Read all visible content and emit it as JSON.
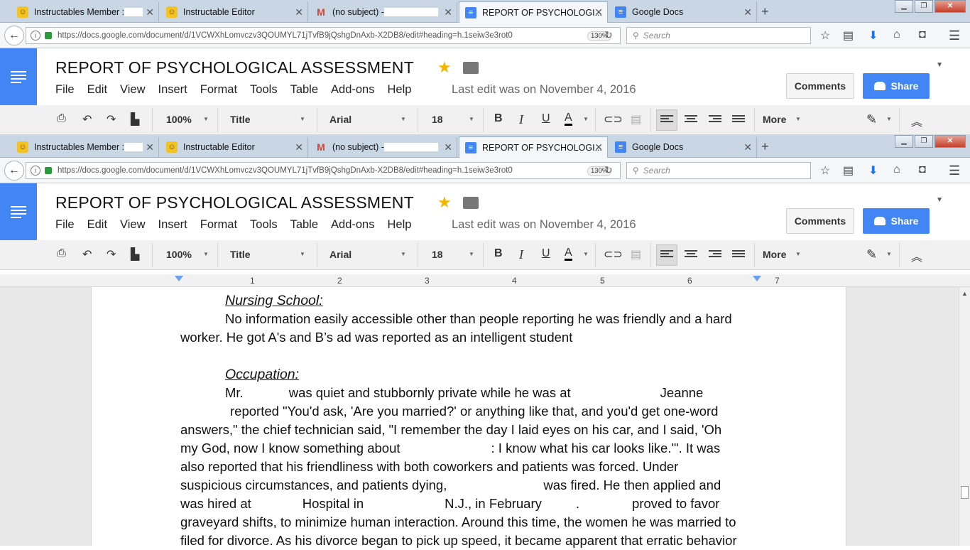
{
  "tabs": [
    {
      "title": "Instructables Member : ",
      "icon": "instructables-icon"
    },
    {
      "title": "Instructable Editor",
      "icon": "instructables-icon"
    },
    {
      "title": "(no subject) - ",
      "icon": "gmail-icon"
    },
    {
      "title": "REPORT OF PSYCHOLOGI...",
      "icon": "docs-icon"
    },
    {
      "title": "Google Docs",
      "icon": "docs-icon"
    }
  ],
  "browser": {
    "url": "https://docs.google.com/document/d/1VCWXhLomvczv3QOUMYL71jTvfB9jQshgDnAxb-X2DB8/edit#heading=h.1seiw3e3rot0",
    "zoom": "130%",
    "search_placeholder": "Search"
  },
  "doc": {
    "title": "REPORT OF PSYCHOLOGICAL ASSESSMENT",
    "last_edit": "Last edit was on November 4, 2016",
    "comments_label": "Comments",
    "share_label": "Share"
  },
  "menus": [
    "File",
    "Edit",
    "View",
    "Insert",
    "Format",
    "Tools",
    "Table",
    "Add-ons",
    "Help"
  ],
  "toolbar": {
    "zoom": "100%",
    "style": "Title",
    "font": "Arial",
    "size": "18",
    "bold": "B",
    "italic": "I",
    "underline": "U",
    "text_color": "A",
    "more": "More"
  },
  "ruler": [
    "1",
    "2",
    "3",
    "4",
    "5",
    "6",
    "7"
  ],
  "content": {
    "heading1": "Nursing School:",
    "para1_line1": "No information easily accessible other than people reporting he was friendly and a hard",
    "para1_line2": "worker. He got A's and B’s ad was reported as an intelligent student",
    "heading2": "Occupation:",
    "p2_l1a": "Mr.",
    "p2_l1b": "was quiet and stubbornly private while he was at",
    "p2_l1c": "Jeanne",
    "p2_l2": "reported \"You'd ask, 'Are you married?' or anything like that, and you'd get one-word",
    "p2_l3": "answers,\" the chief technician said, \"I remember the day I laid eyes on his car, and I said, 'Oh",
    "p2_l4a": "my God, now I know something about",
    "p2_l4b": ": I know what his car looks like.'\". It was",
    "p2_l5": "also reported that his friendliness with both coworkers and patients was forced. Under",
    "p2_l6a": "suspicious circumstances, and patients dying,",
    "p2_l6b": "was fired. He then applied and",
    "p2_l7a": "was hired at",
    "p2_l7b": "Hospital in",
    "p2_l7c": "N.J., in February",
    "p2_l7d": ".",
    "p2_l7e": "proved to favor",
    "p2_l8": "graveyard shifts, to minimize human interaction. Around this time, the women he was married to",
    "p2_l9": "filed for divorce. As his divorce began to pick up speed, it became apparent that erratic behavior"
  }
}
